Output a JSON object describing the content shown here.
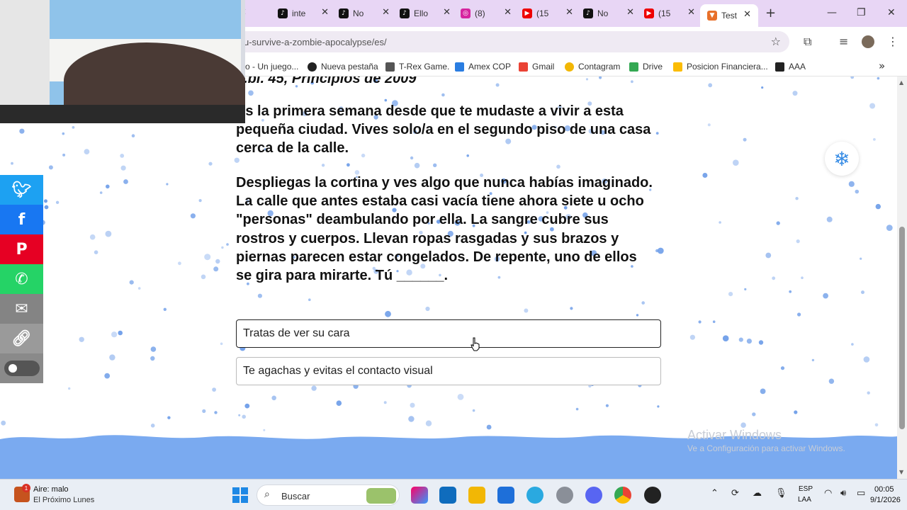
{
  "browser": {
    "tabs": [
      {
        "label": "inte",
        "icon": "tiktok-icon"
      },
      {
        "label": "No",
        "icon": "tiktok-icon"
      },
      {
        "label": "Ello",
        "icon": "tiktok-icon"
      },
      {
        "label": "(8)",
        "icon": "instagram-icon"
      },
      {
        "label": "(15",
        "icon": "youtube-icon"
      },
      {
        "label": "No",
        "icon": "tiktok-icon"
      },
      {
        "label": "(15",
        "icon": "youtube-icon"
      },
      {
        "label": "Test",
        "icon": "fox-icon",
        "active": true
      }
    ],
    "url": "u-survive-a-zombie-apocalypse/es/",
    "bookmarks": [
      "o - Un juego...",
      "Nueva pestaña",
      "T-Rex Game.",
      "Amex COP",
      "Gmail",
      "Contagram",
      "Drive",
      "Posicion Financiera...",
      "AAA"
    ]
  },
  "page": {
    "chapter": "...bl. 45, Principios de 2009",
    "paragraph1": "Es la primera semana desde que te mudaste a vivir a esta pequeña ciudad. Vives solo/a en el segundo piso de una casa cerca de la calle.",
    "paragraph2": "Despliegas la cortina y ves algo que nunca habías imaginado. La calle que antes estaba casi vacía tiene ahora siete u ocho \"personas\" deambulando por ella. La sangre cubre sus rostros y cuerpos. Llevan ropas rasgadas y sus brazos y piernas parecen estar congelados. De repente, uno de ellos se gira para mirarte. Tú ______.",
    "options": [
      "Tratas de ver su cara",
      "Te agachas y evitas el contacto visual"
    ],
    "watermark_title": "Activar Windows",
    "watermark_sub": "Ve a Configuración para activar Windows.",
    "colors": {
      "snow": "#6a9be8",
      "wave": "#7aaaf0",
      "snow_button": "#3a8ee6"
    }
  },
  "share_bar": [
    {
      "icon": "twitter-icon",
      "color": "#1da1f2"
    },
    {
      "icon": "facebook-icon",
      "color": "#1877f2"
    },
    {
      "icon": "pinterest-icon",
      "color": "#e60023"
    },
    {
      "icon": "whatsapp-icon",
      "color": "#25d366"
    },
    {
      "icon": "email-icon",
      "color": "#848484"
    },
    {
      "icon": "link-icon",
      "color": "#9a9a9a"
    }
  ],
  "taskbar": {
    "weather_title": "Aire: malo",
    "weather_sub": "El Próximo Lunes",
    "weather_badge": "1",
    "search_placeholder": "Buscar",
    "lang1": "ESP",
    "lang2": "LAA",
    "time": "00:05",
    "date": "9/1/2026"
  }
}
